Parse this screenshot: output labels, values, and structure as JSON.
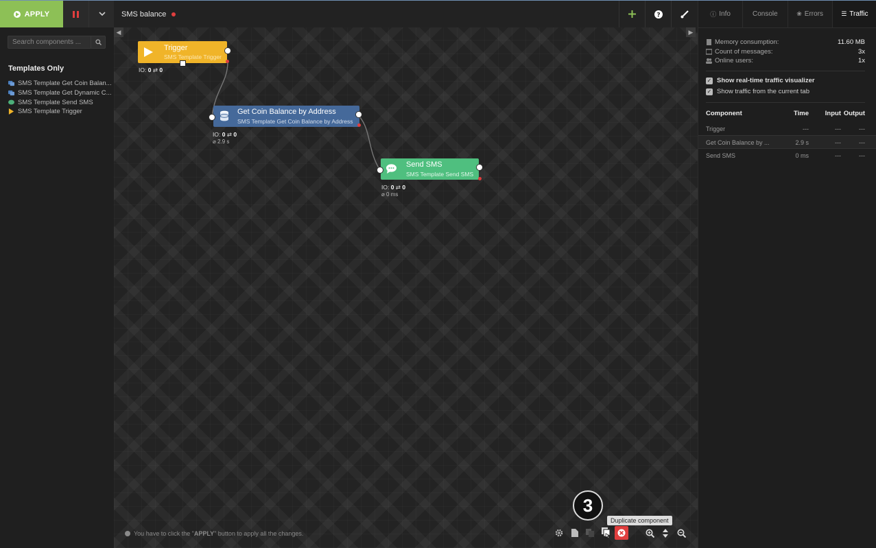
{
  "toolbar": {
    "apply_label": "APPLY",
    "flow_title": "SMS balance"
  },
  "sidebar": {
    "search_placeholder": "Search components ...",
    "section_title": "Templates Only",
    "items": [
      {
        "label": "SMS Template Get Coin Balan...",
        "icon": "database-icon",
        "color": "#4a7fbf"
      },
      {
        "label": "SMS Template Get Dynamic C...",
        "icon": "database-icon",
        "color": "#4a7fbf"
      },
      {
        "label": "SMS Template Send SMS",
        "icon": "chat-icon",
        "color": "#4caf7a"
      },
      {
        "label": "SMS Template Trigger",
        "icon": "play-icon",
        "color": "#f0b429"
      }
    ]
  },
  "canvas": {
    "nodes": [
      {
        "title": "Trigger",
        "subtitle": "SMS Template Trigger",
        "io_in": "0",
        "io_out": "0",
        "duration": "",
        "color": "#f0b429"
      },
      {
        "title": "Get Coin Balance by Address",
        "subtitle": "SMS Template Get Coin Balance by Address",
        "io_in": "0",
        "io_out": "0",
        "duration": "⌀ 2.9 s",
        "color": "#45699a"
      },
      {
        "title": "Send SMS",
        "subtitle": "SMS Template Send SMS",
        "io_in": "0",
        "io_out": "0",
        "duration": "⌀ 0 ms",
        "color": "#4fbf7f"
      }
    ],
    "io_label": "IO:",
    "io_arrow": "⇄",
    "hint_prefix": "You have to click the \"",
    "hint_bold": "APPLY",
    "hint_suffix": "\" button to apply all the changes.",
    "step_badge": "3",
    "tooltip": "Duplicate component"
  },
  "panel": {
    "tabs": [
      {
        "label": "Info",
        "icon": "info-icon"
      },
      {
        "label": "Console",
        "icon": ""
      },
      {
        "label": "Errors",
        "icon": "bug-icon"
      },
      {
        "label": "Traffic",
        "icon": "list-icon"
      }
    ],
    "stats": [
      {
        "label": "Memory consumption:",
        "value": "11.60 MB"
      },
      {
        "label": "Count of messages:",
        "value": "3x"
      },
      {
        "label": "Online users:",
        "value": "1x"
      }
    ],
    "options": [
      {
        "label": "Show real-time traffic visualizer",
        "checked": true
      },
      {
        "label": "Show traffic from the current tab",
        "checked": true
      }
    ],
    "table": {
      "headers": [
        "Component",
        "Time",
        "Input",
        "Output"
      ],
      "rows": [
        [
          "Trigger",
          "---",
          "---",
          "---"
        ],
        [
          "Get Coin Balance by ...",
          "2.9 s",
          "---",
          "---"
        ],
        [
          "Send SMS",
          "0 ms",
          "---",
          "---"
        ]
      ]
    }
  }
}
